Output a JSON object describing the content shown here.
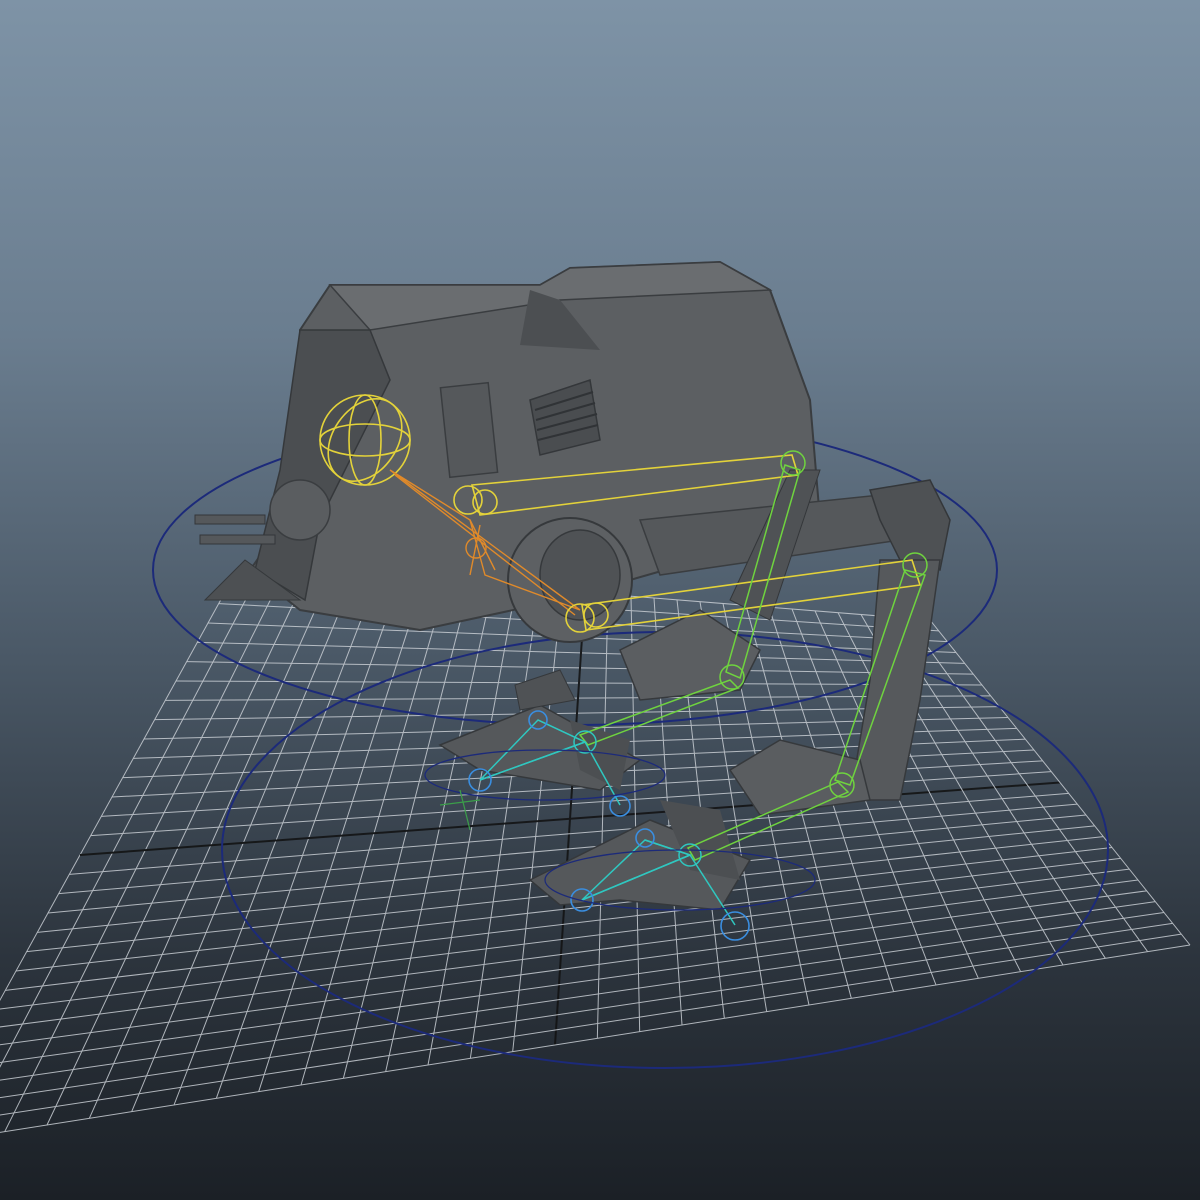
{
  "viewport": {
    "background_top": "#7e93a6",
    "background_bottom": "#1b2026"
  },
  "colors": {
    "grid": "#c9ced4",
    "grid_axis": "#111111",
    "control_circle": "#1c2a7a",
    "body_mesh": "#5a5d60",
    "body_mesh_dark": "#3e4144",
    "spine_ik": "#e3d23a",
    "pelvis_joint": "#e08a2a",
    "leg_ik": "#6fd33f",
    "foot_joint": "#2fc7c0",
    "foot_control": "#3a8ee0"
  },
  "scene": {
    "model": "walker-rig",
    "icons": [
      "rig-control-sphere-icon",
      "joint-icon",
      "ik-handle-icon"
    ]
  }
}
